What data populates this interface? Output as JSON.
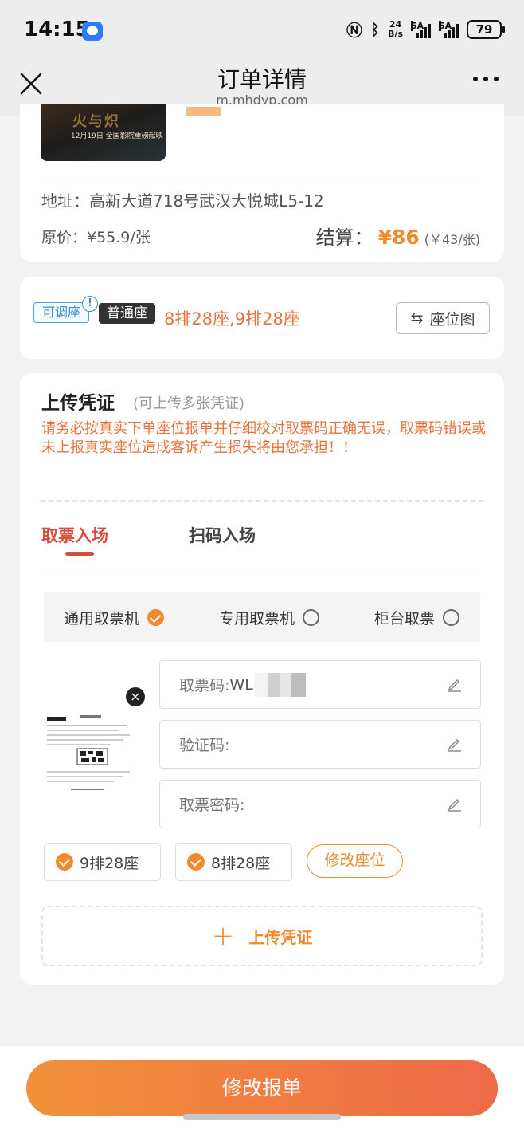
{
  "status_bar": {
    "time": "14:15",
    "net_speed_top": "24",
    "net_speed_bottom": "B/s",
    "sim1": "5A",
    "sim2": "5A",
    "battery": "79"
  },
  "nav": {
    "title": "订单详情",
    "domain": "m.mhdyp.com"
  },
  "movie": {
    "poster_text": "火与炽",
    "poster_date": "12月19日 全国影院重磅献映",
    "address": "地址：高新大道718号武汉大悦城L5-12",
    "original_price": "原价：¥55.9/张",
    "settle_label": "结算：",
    "settle_price": "¥86",
    "settle_unit": "(￥43/张)"
  },
  "seat": {
    "tag_adjustable": "可调座",
    "info_icon": "!",
    "tag_type": "普通座",
    "seats": "8排28座,9排28座",
    "seat_map_button": "座位图",
    "seat_map_icon": "⇆"
  },
  "upload": {
    "title": "上传凭证",
    "subtitle": "(可上传多张凭证)",
    "warning": "请务必按真实下单座位报单并仔细校对取票码正确无误，取票码错误或未上报真实座位造成客诉产生损失将由您承担！！",
    "tabs": [
      "取票入场",
      "扫码入场"
    ],
    "machines": [
      {
        "label": "通用取票机",
        "selected": true
      },
      {
        "label": "专用取票机",
        "selected": false
      },
      {
        "label": "柜台取票",
        "selected": false
      }
    ],
    "thumb_close": "×",
    "fields": [
      {
        "label": "取票码:",
        "value": "WL"
      },
      {
        "label": "验证码:",
        "value": ""
      },
      {
        "label": "取票密码:",
        "value": ""
      }
    ],
    "seat_chips": [
      "9排28座",
      "8排28座"
    ],
    "modify_seat_button": "修改座位",
    "upload_plus": "+",
    "upload_button": "上传凭证"
  },
  "footer": {
    "main_button": "修改报单"
  },
  "colors": {
    "accent_orange": "#f08a2c",
    "tab_red": "#d64b3a",
    "tag_blue": "#3a8fd1"
  }
}
